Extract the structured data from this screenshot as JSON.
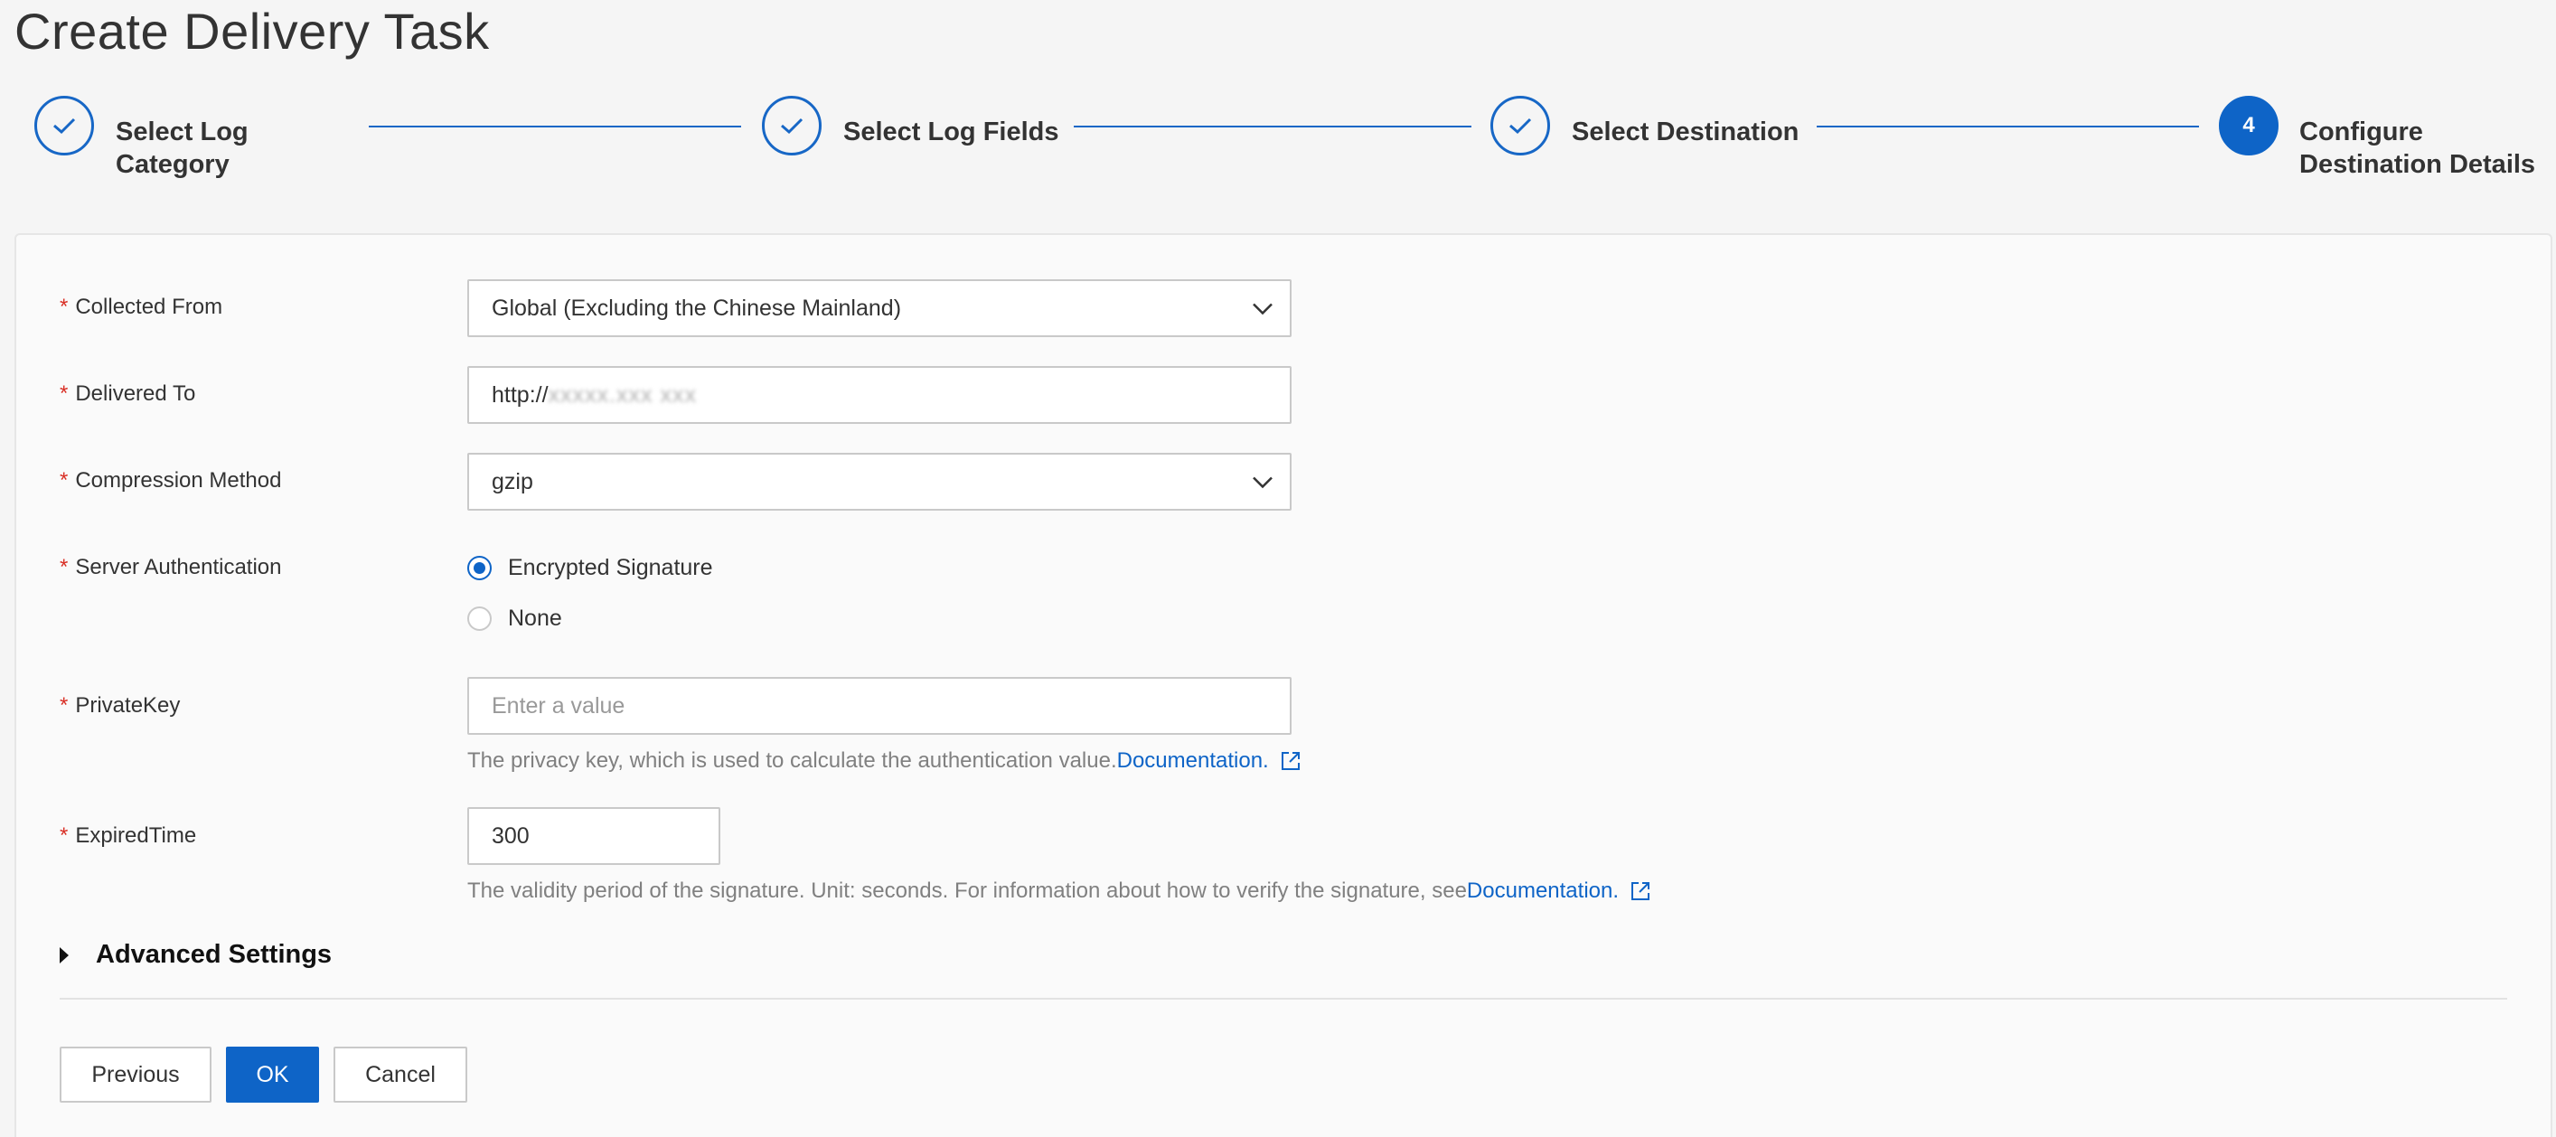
{
  "page": {
    "title": "Create Delivery Task"
  },
  "steps": [
    {
      "label_line1": "Select Log",
      "label_line2": "Category",
      "status": "done"
    },
    {
      "label_line1": "Select Log Fields",
      "label_line2": "",
      "status": "done"
    },
    {
      "label_line1": "Select Destination",
      "label_line2": "",
      "status": "done"
    },
    {
      "number": "4",
      "label_line1": "Configure",
      "label_line2": "Destination Details",
      "status": "active"
    }
  ],
  "form": {
    "collected_from": {
      "label": "Collected From",
      "value": "Global (Excluding the Chinese Mainland)"
    },
    "delivered_to": {
      "label": "Delivered To",
      "value_prefix": "http://",
      "value_blurred": "xxxxx.xxx xxx"
    },
    "compression": {
      "label": "Compression Method",
      "value": "gzip"
    },
    "server_auth": {
      "label": "Server Authentication",
      "options": [
        {
          "label": "Encrypted Signature",
          "selected": true
        },
        {
          "label": "None",
          "selected": false
        }
      ]
    },
    "private_key": {
      "label": "PrivateKey",
      "placeholder": "Enter a value",
      "help": "The privacy key, which is used to calculate the authentication value.",
      "help_link": "Documentation."
    },
    "expired_time": {
      "label": "ExpiredTime",
      "value": "300",
      "help": "The validity period of the signature. Unit: seconds. For information about how to verify the signature, see",
      "help_link": "Documentation."
    },
    "required_mark": "*"
  },
  "advanced": {
    "label": "Advanced Settings"
  },
  "buttons": {
    "previous": "Previous",
    "ok": "OK",
    "cancel": "Cancel"
  },
  "colors": {
    "primary": "#0e64c7",
    "required": "#d93026"
  }
}
